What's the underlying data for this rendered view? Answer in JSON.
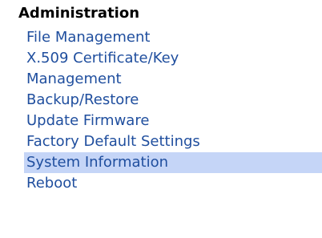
{
  "nav": {
    "section_title": "Administration",
    "items": [
      {
        "label": "File Management"
      },
      {
        "label": "X.509 Certificate/Key Management"
      },
      {
        "label": "Backup/Restore"
      },
      {
        "label": "Update Firmware"
      },
      {
        "label": "Factory Default Settings"
      },
      {
        "label": "System Information",
        "selected": true
      },
      {
        "label": "Reboot"
      }
    ]
  },
  "colors": {
    "link": "#1f4e9e",
    "selected_background": "#c5d5f7",
    "title": "#000000"
  }
}
